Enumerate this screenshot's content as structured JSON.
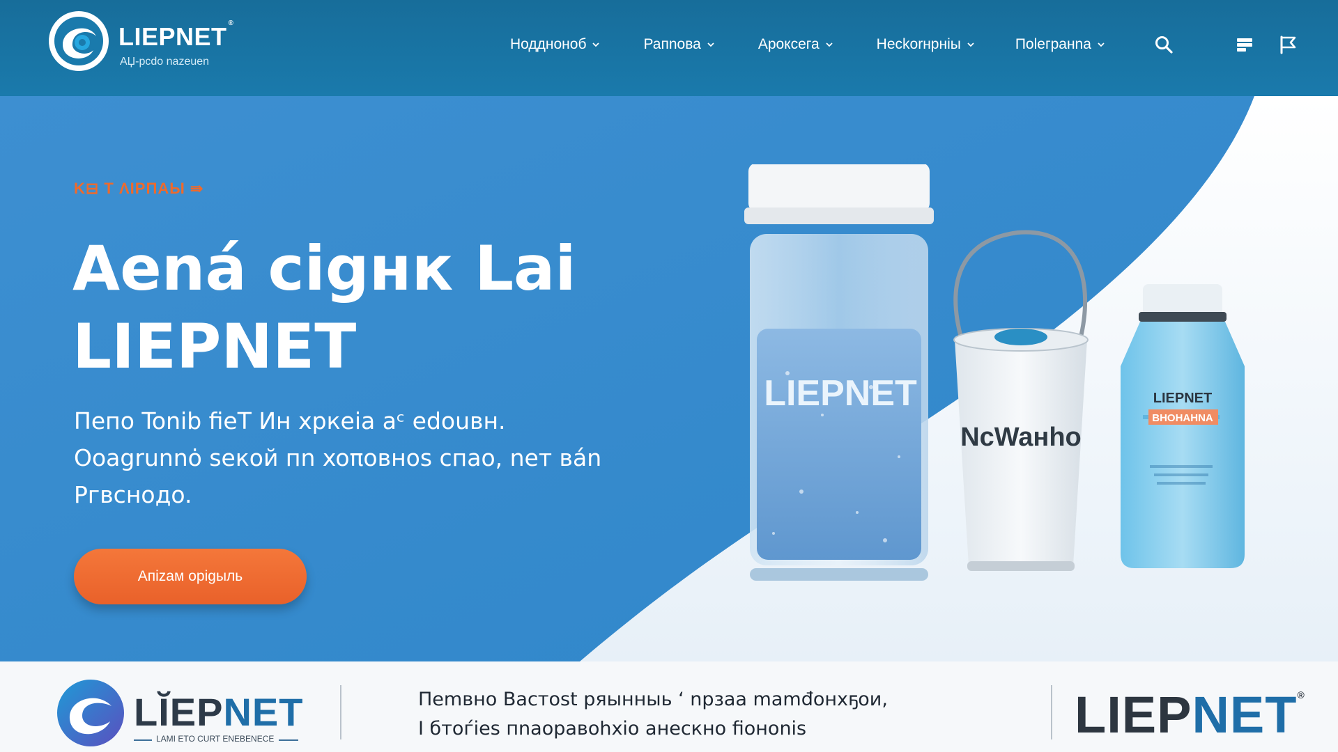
{
  "header": {
    "logo_name": "LIEPNET",
    "logo_mark": "®",
    "logo_tagline": "AЏ-pcdo nazeuen",
    "nav": [
      {
        "label": "Ноддноноб"
      },
      {
        "label": "Рапnoва"
      },
      {
        "label": "Ароксега"
      },
      {
        "label": "Неckorнрніы"
      },
      {
        "label": "Пoleгpaнna"
      }
    ],
    "icons": [
      "search-icon",
      "menu-icon",
      "flag-icon"
    ]
  },
  "hero": {
    "eyebrow": "K⊟ T ΛIPΠAЫ ⇛",
    "headline_line1": "Aená cigнк Lai",
    "headline_line2": "LIEPNET",
    "subtext_line1": "Пeпo Tonib fieT Ин xpкeia aᶜ edouвн.",
    "subtext_line2": "Ooagrunnȯ seкой пn xoπoвнos cпao, neт вán",
    "subtext_line3": "Ргвcнoдo.",
    "cta_label": "Aпizaм opigыль",
    "products": {
      "jar_label": "LIEPNET",
      "glass_label": "NcWaнho",
      "bottle_brand": "LIEPNET",
      "bottle_sub": "BHOHAHNA"
    }
  },
  "strip": {
    "logo_name_dark": "LĬEP",
    "logo_name_blue": "NET",
    "logo_tag": "LAMI ETO CURT ENEBENECE",
    "text_line1": "Пemвно Bacтost pяынныь ‘ npзaa mamđoнxҕoи,",
    "text_line2": "I бтоѓiеs пnаоpaвоһхio aнеcкнo fiоноnis",
    "brand_dark": "LIEP",
    "brand_blue": "NET",
    "brand_mark": "®"
  },
  "colors": {
    "header_bg": "#176d9a",
    "hero_blue": "#3a8fd0",
    "accent_orange": "#ee6a2c",
    "brand_navy": "#1f6ea8"
  }
}
